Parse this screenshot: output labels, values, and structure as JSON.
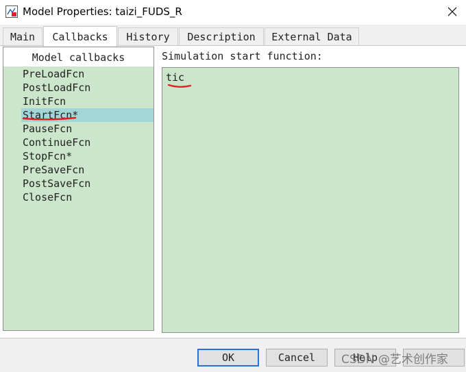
{
  "window": {
    "title": "Model Properties: taizi_FUDS_R",
    "icon": "simulink-model-icon",
    "close_icon": "close-icon"
  },
  "tabs": [
    {
      "label": "Main",
      "active": false
    },
    {
      "label": "Callbacks",
      "active": true
    },
    {
      "label": "History",
      "active": false
    },
    {
      "label": "Description",
      "active": false
    },
    {
      "label": "External Data",
      "active": false
    }
  ],
  "callbacks_panel": {
    "header": "Model callbacks",
    "items": [
      {
        "label": "PreLoadFcn",
        "selected": false
      },
      {
        "label": "PostLoadFcn",
        "selected": false
      },
      {
        "label": "InitFcn",
        "selected": false
      },
      {
        "label": "StartFcn*",
        "selected": true
      },
      {
        "label": "PauseFcn",
        "selected": false
      },
      {
        "label": "ContinueFcn",
        "selected": false
      },
      {
        "label": "StopFcn*",
        "selected": false
      },
      {
        "label": "PreSaveFcn",
        "selected": false
      },
      {
        "label": "PostSaveFcn",
        "selected": false
      },
      {
        "label": "CloseFcn",
        "selected": false
      }
    ]
  },
  "editor": {
    "label": "Simulation start function:",
    "value": "tic"
  },
  "buttons": {
    "ok": "OK",
    "cancel": "Cancel",
    "help": "Help"
  },
  "watermark": "CSDN @艺术创作家",
  "colors": {
    "panel_background": "#cbe6ca",
    "selection": "#a3d6d6",
    "annotation_underline": "#e0201b",
    "default_button_border": "#2d6fd0"
  }
}
